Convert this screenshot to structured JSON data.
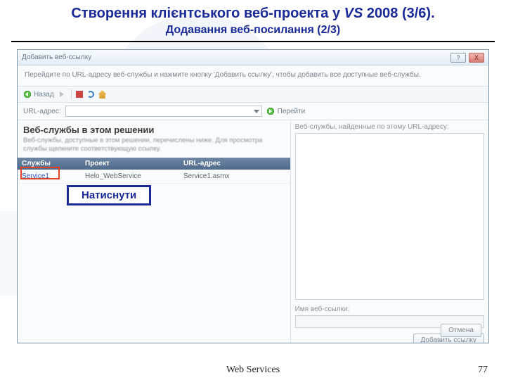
{
  "slide": {
    "title_a": "Створення клієнтського веб-проекта у ",
    "title_vs": "VS",
    "title_b": " 2008 (3/6).",
    "subtitle": "Додавання веб-посилання (2/3)"
  },
  "dialog": {
    "caption": "Добавить веб-ссылку",
    "instruction": "Перейдите по URL-адресу веб-службы и нажмите кнопку 'Добавить ссылку', чтобы добавить все доступные веб-службы.",
    "back_label": "Назад",
    "url_label": "URL-адрес:",
    "url_value": "",
    "go_label": "Перейти",
    "solutions_header": "Веб-службы в этом решении",
    "solutions_desc": "Веб-службы, доступные в этом решении, перечислены ниже. Для просмотра службы щелкните соответствующую ссылку.",
    "grid": {
      "columns": [
        "Службы",
        "Проект",
        "URL-адрес"
      ],
      "rows": [
        {
          "service": "Service1",
          "project": "Helo_WebService",
          "url": "Service1.asmx"
        }
      ]
    },
    "right": {
      "found_label": "Веб-службы, найденные по этому URL-адресу:",
      "name_label": "Имя веб-ссылки:",
      "name_value": "",
      "add_btn": "Добавить ссылку"
    },
    "cancel_btn": "Отмена"
  },
  "callout": {
    "text": "Натиснути"
  },
  "footer": {
    "text": "Web Services",
    "page": "77"
  }
}
